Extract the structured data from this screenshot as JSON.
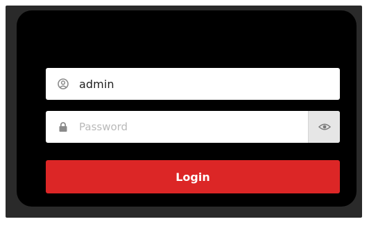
{
  "login_form": {
    "username": {
      "value": "admin",
      "icon": "user-icon"
    },
    "password": {
      "placeholder": "Password",
      "icon": "lock-icon",
      "toggle_icon": "eye-icon"
    },
    "login_button": {
      "label": "Login"
    }
  },
  "colors": {
    "outer_frame": "#2a2a2a",
    "panel_background": "#000000",
    "field_background": "#ffffff",
    "toggle_background": "#e6e6e6",
    "login_button": "#dc2626",
    "login_button_text": "#ffffff",
    "placeholder_text": "#b9b9b9",
    "icon_gray": "#8a8a8a"
  }
}
